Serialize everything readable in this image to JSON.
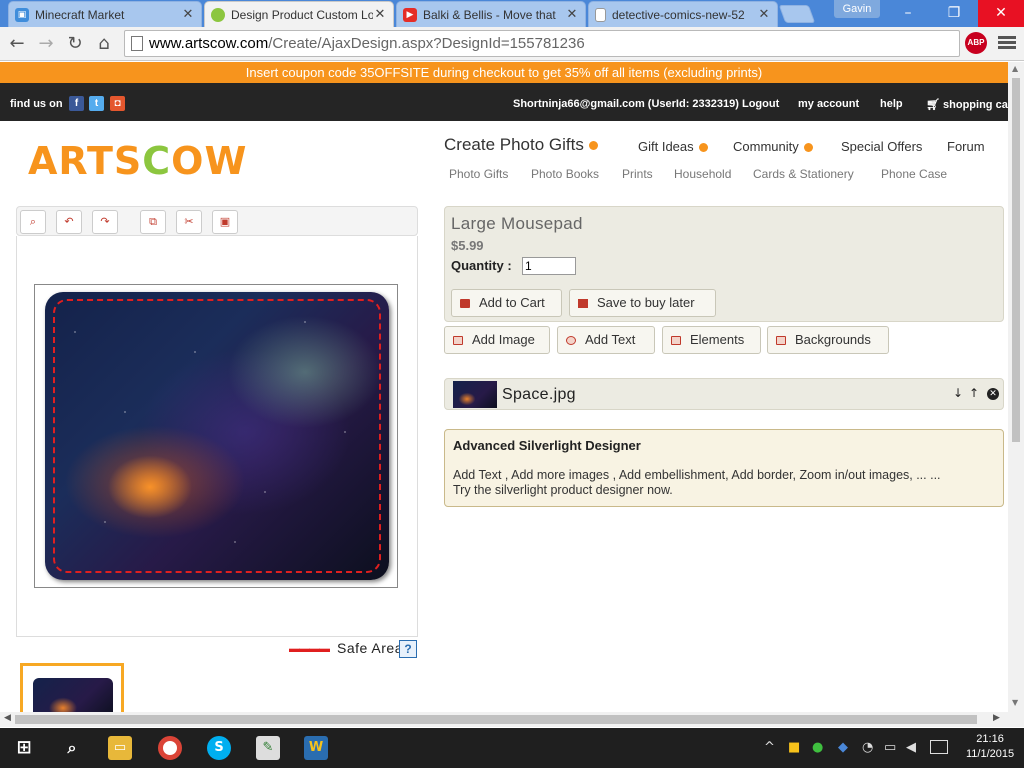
{
  "browser": {
    "tabs": [
      {
        "title": "Minecraft Market",
        "active": false,
        "icon": "minecraft-market-icon"
      },
      {
        "title": "Design Product Custom Lo",
        "active": true,
        "icon": "artscow-icon"
      },
      {
        "title": "Balki & Bellis - Move that",
        "active": false,
        "icon": "youtube-icon"
      },
      {
        "title": "detective-comics-new-52",
        "active": false,
        "icon": "page-icon"
      }
    ],
    "close_glyph": "✕",
    "user_name": "Gavin",
    "url_host": "www.artscow.com",
    "url_path": "/Create/AjaxDesign.aspx?DesignId=155781236",
    "abp_label": "ABP"
  },
  "site": {
    "coupon_text": "Insert coupon code 35OFFSITE during checkout to get 35% off all items (excluding prints)",
    "find_us": "find us on",
    "account_text": "Shortninja66@gmail.com (UserId: 2332319) Logout",
    "my_account": "my account",
    "help": "help",
    "cart": "shopping car",
    "logo_orange_1": "ARTS",
    "logo_green": "C",
    "logo_orange_2": "OW",
    "nav": {
      "create_photo_gifts": "Create Photo Gifts",
      "gift_ideas": "Gift Ideas",
      "community": "Community",
      "special_offers": "Special Offers",
      "forum": "Forum"
    },
    "subnav": [
      "Photo Gifts",
      "Photo Books",
      "Prints",
      "Household",
      "Cards & Stationery",
      "Phone Case"
    ]
  },
  "designer": {
    "toolbar_icons": [
      "zoom-icon",
      "undo-icon",
      "redo-icon",
      "copy-icon",
      "cut-icon",
      "paste-icon"
    ],
    "safe_area_label": "Safe Area",
    "safe_area_help": "?"
  },
  "product": {
    "title": "Large Mousepad",
    "price": "$5.99",
    "quantity_label": "Quantity :",
    "quantity_value": "1",
    "add_to_cart": "Add to Cart",
    "save_later": "Save to buy later",
    "add_image": "Add Image",
    "add_text": "Add Text",
    "elements": "Elements",
    "backgrounds": "Backgrounds",
    "layer_name": "Space.jpg"
  },
  "advanced": {
    "title": "Advanced Silverlight Designer",
    "line1": "Add Text , Add more images , Add embellishment, Add border, Zoom in/out images, ... ...",
    "line2": "Try the silverlight product designer now."
  },
  "taskbar": {
    "time": "21:16",
    "date": "11/1/2015"
  },
  "colors": {
    "brand_orange": "#f7941d",
    "brand_green": "#8cc63f",
    "safe_area_red": "#e01f1f",
    "tabstrip_blue": "#4a87d8"
  }
}
